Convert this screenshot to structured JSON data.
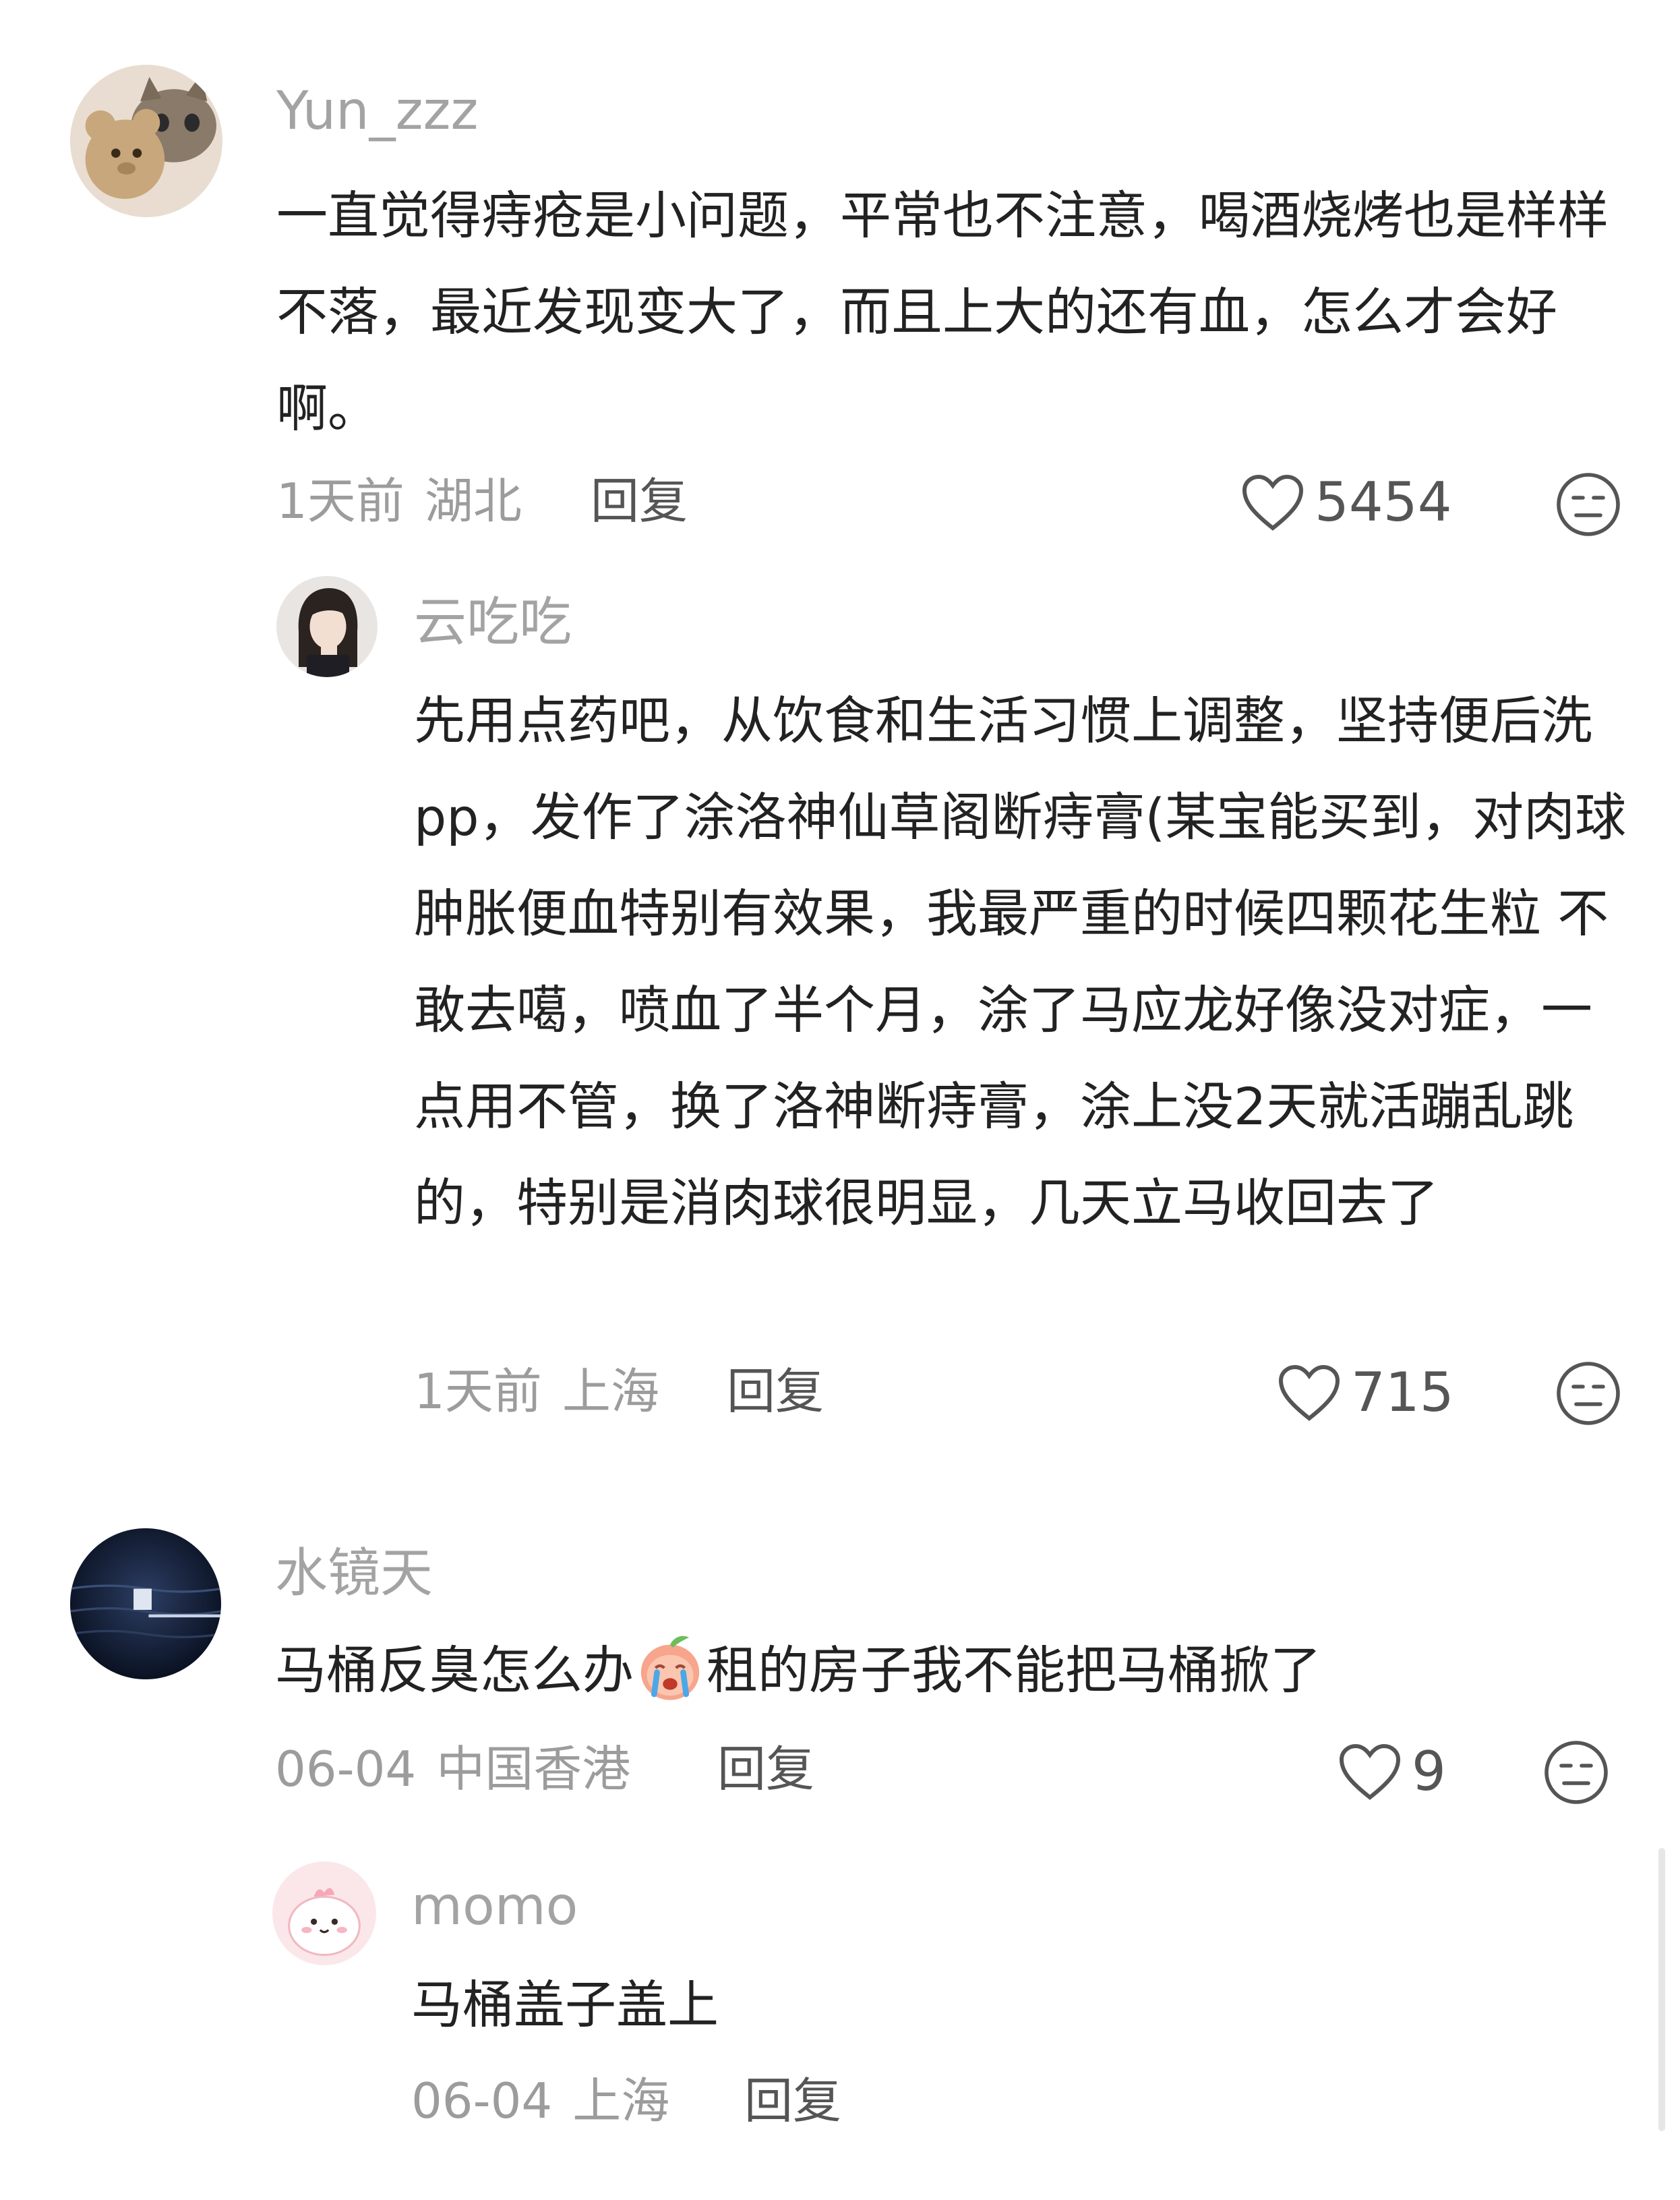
{
  "comments": [
    {
      "user": "Yun_zzz",
      "text": "一直觉得痔疮是小问题，平常也不注意，喝酒烧烤也是样样不落，最近发现变大了，而且上大的还有血，怎么才会好啊。",
      "time": "1天前",
      "location": "湖北",
      "reply_label": "回复",
      "likes": "5454",
      "avatar_icon": "cat-with-teddy-bear-avatar",
      "replies": [
        {
          "user": "云吃吃",
          "text": "先用点药吧，从饮食和生活习惯上调整，坚持便后洗pp，发作了涂洛神仙草阁断痔膏(某宝能买到，对肉球肿胀便血特别有效果，我最严重的时候四颗花生粒 不敢去噶，喷血了半个月，涂了马应龙好像没对症，一点用不管，换了洛神断痔膏，涂上没2天就活蹦乱跳的，特别是消肉球很明显，几天立马收回去了",
          "time": "1天前",
          "location": "上海",
          "reply_label": "回复",
          "likes": "715",
          "avatar_icon": "girl-portrait-avatar"
        }
      ]
    },
    {
      "user": "水镜天",
      "text_before": "马桶反臭怎么办",
      "emoji": "crying-peach-emoji",
      "text_after": "租的房子我不能把马桶掀了",
      "time": "06-04",
      "location": "中国香港",
      "reply_label": "回复",
      "likes": "9",
      "avatar_icon": "ocean-night-avatar",
      "replies": [
        {
          "user": "momo",
          "text": "马桶盖子盖上",
          "time": "06-04",
          "location": "上海",
          "reply_label": "回复",
          "avatar_icon": "pink-cartoon-avatar"
        }
      ]
    }
  ],
  "icons": {
    "like": "heart-outline-icon",
    "dislike": "unamused-face-icon"
  },
  "colors": {
    "username": "#a3a3a3",
    "body": "#222222",
    "meta": "#9c9c9c",
    "action": "#555555"
  }
}
